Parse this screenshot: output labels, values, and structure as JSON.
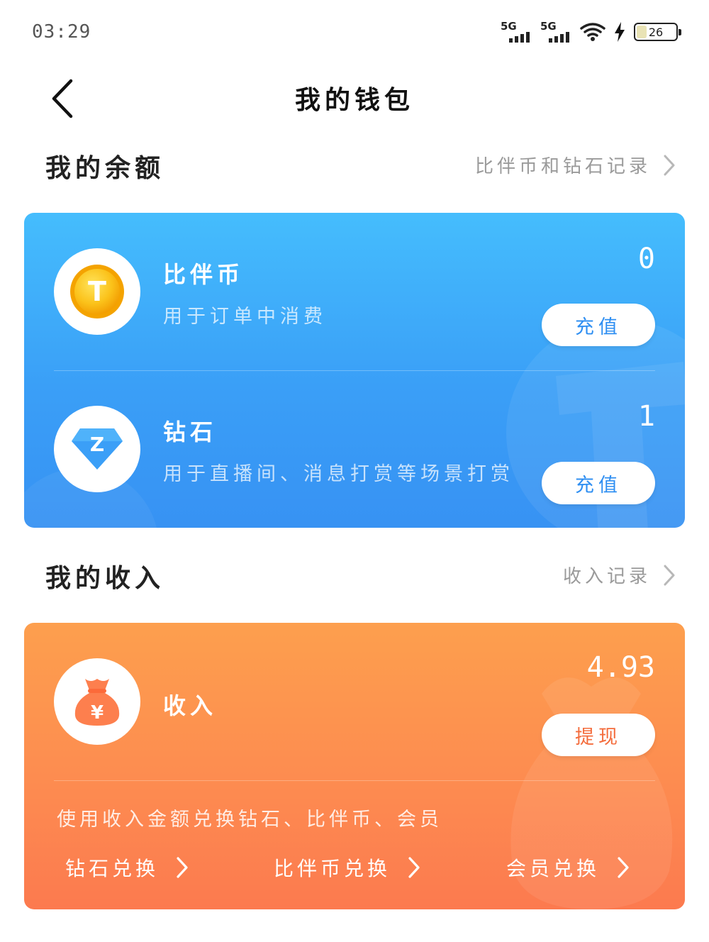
{
  "status_bar": {
    "time": "03:29",
    "signal1_label": "5G",
    "signal2_label": "5G",
    "battery_level": "26"
  },
  "nav": {
    "title": "我的钱包"
  },
  "balance_section": {
    "title": "我的余额",
    "link_label": "比伴币和钻石记录"
  },
  "balance_items": [
    {
      "name": "比伴币",
      "description": "用于订单中消费",
      "value": "0",
      "button_label": "充值",
      "icon_letter": "T"
    },
    {
      "name": "钻石",
      "description": "用于直播间、消息打赏等场景打赏",
      "value": "1",
      "button_label": "充值",
      "icon_letter": "Z"
    }
  ],
  "income_section": {
    "title": "我的收入",
    "link_label": "收入记录"
  },
  "income": {
    "name": "收入",
    "value": "4.93",
    "button_label": "提现",
    "icon_symbol": "¥",
    "exchange_description": "使用收入金额兑换钻石、比伴币、会员",
    "exchange_links": [
      "钻石兑换",
      "比伴币兑换",
      "会员兑换"
    ]
  },
  "colors": {
    "blue_card_top": "#45bdfd",
    "blue_card_bottom": "#3792f3",
    "orange_card_top": "#fd9f4e",
    "orange_card_bottom": "#fc7a4f",
    "coin_gold": "#f5b800",
    "diamond_blue": "#3a9ff7",
    "moneybag_orange": "#fd7f4e"
  }
}
